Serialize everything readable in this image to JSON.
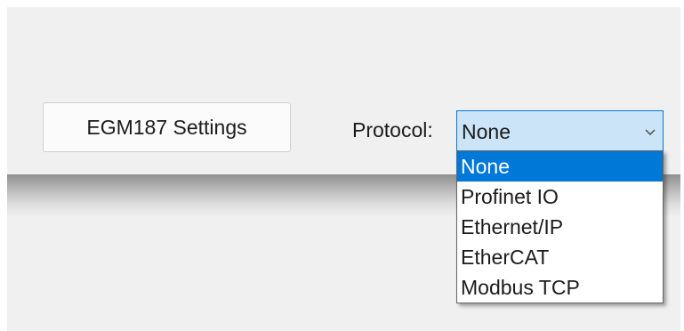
{
  "settings_button": {
    "label": "EGM187 Settings"
  },
  "protocol": {
    "label": "Protocol:",
    "selected_value": "None",
    "options": [
      {
        "label": "None",
        "selected": true
      },
      {
        "label": "Profinet IO",
        "selected": false
      },
      {
        "label": "Ethernet/IP",
        "selected": false
      },
      {
        "label": "EtherCAT",
        "selected": false
      },
      {
        "label": "Modbus TCP",
        "selected": false
      }
    ]
  },
  "icons": {
    "dropdown_arrow": "chevron-down-icon"
  },
  "colors": {
    "accent": "#0078d7",
    "select_background": "#cce4f7",
    "panel_background": "#f0f0f0"
  }
}
